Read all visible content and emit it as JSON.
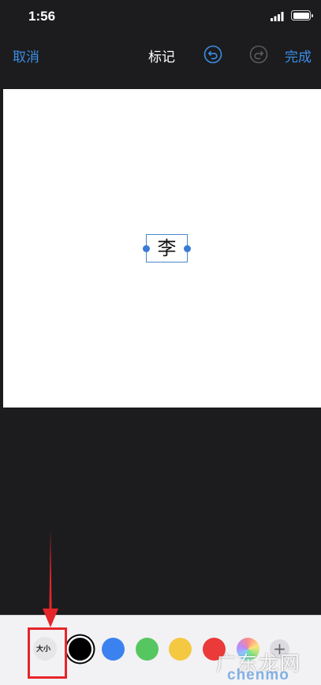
{
  "status_bar": {
    "time": "1:56"
  },
  "nav": {
    "cancel": "取消",
    "title": "标记",
    "done": "完成"
  },
  "canvas": {
    "text": "李"
  },
  "toolbar": {
    "size_label": "大小",
    "colors": {
      "black": "#000000",
      "blue": "#3b82f0",
      "green": "#56c760",
      "yellow": "#f5c842",
      "red": "#ea3a3a"
    },
    "plus": "+"
  },
  "annotation": {
    "color": "#e5252a"
  },
  "watermark": {
    "title": "广东龙网",
    "sub": "chenmo"
  },
  "accent": "#3a8ee6"
}
